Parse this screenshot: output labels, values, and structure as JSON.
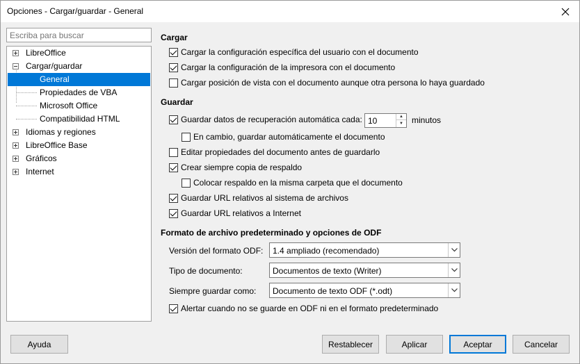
{
  "window": {
    "title": "Opciones - Cargar/guardar - General"
  },
  "search": {
    "placeholder": "Escriba para buscar"
  },
  "tree": [
    {
      "label": "LibreOffice"
    },
    {
      "label": "Cargar/guardar"
    },
    {
      "label": "General"
    },
    {
      "label": "Propiedades de VBA"
    },
    {
      "label": "Microsoft Office"
    },
    {
      "label": "Compatibilidad HTML"
    },
    {
      "label": "Idiomas y regiones"
    },
    {
      "label": "LibreOffice Base"
    },
    {
      "label": "Gráficos"
    },
    {
      "label": "Internet"
    }
  ],
  "cargar": {
    "title": "Cargar",
    "options": [
      {
        "label": "Cargar la configuración específica del usuario con el documento",
        "checked": true
      },
      {
        "label": "Cargar la configuración de la impresora con el documento",
        "checked": true
      },
      {
        "label": "Cargar posición de vista con el documento aunque otra persona lo haya guardado",
        "checked": false
      }
    ]
  },
  "guardar": {
    "title": "Guardar",
    "autorecovery_label": "Guardar datos de recuperación automática cada:",
    "autorecovery_checked": true,
    "autorecovery_value": "10",
    "autorecovery_unit": "minutos",
    "options": [
      {
        "label": "En cambio, guardar automáticamente el documento",
        "checked": false
      },
      {
        "label": "Editar propiedades del documento antes de guardarlo",
        "checked": false
      },
      {
        "label": "Crear siempre copia de respaldo",
        "checked": true
      },
      {
        "label": "Colocar respaldo en la misma carpeta que el documento",
        "checked": false
      },
      {
        "label": "Guardar URL relativos al sistema de archivos",
        "checked": true
      },
      {
        "label": "Guardar URL relativos a Internet",
        "checked": true
      }
    ]
  },
  "odf": {
    "title": "Formato de archivo predeterminado y opciones de ODF",
    "version_label": "Versión del formato ODF:",
    "version_value": "1.4 ampliado (recomendado)",
    "doctype_label": "Tipo de documento:",
    "doctype_value": "Documentos de texto (Writer)",
    "saveas_label": "Siempre guardar como:",
    "saveas_value": "Documento de texto ODF (*.odt)",
    "warn_label": "Alertar cuando no se guarde en ODF ni en el formato predeterminado",
    "warn_checked": true
  },
  "buttons": {
    "help": "Ayuda",
    "reset": "Restablecer",
    "apply": "Aplicar",
    "ok": "Aceptar",
    "cancel": "Cancelar"
  }
}
